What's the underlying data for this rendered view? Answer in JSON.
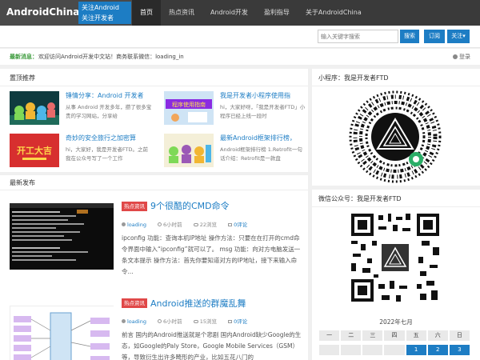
{
  "header": {
    "brand": "AndroidChina",
    "brand_tagline_1": "关注Android",
    "brand_tagline_2": "关注开发者",
    "nav": [
      {
        "label": "首页",
        "active": true
      },
      {
        "label": "热点资讯"
      },
      {
        "label": "Android开发"
      },
      {
        "label": "盈利指导"
      },
      {
        "label": "关于AndroidChina"
      }
    ]
  },
  "search": {
    "placeholder": "输入关键字搜索",
    "search_label": "搜索",
    "subscribe_label": "订阅",
    "follow_label": "关注▾"
  },
  "notice": {
    "label": "最新消息：",
    "text": "欢迎访问Android开发中文站！商务联系微信：loading_in",
    "login": "登录"
  },
  "recommend": {
    "title": "置顶推荐",
    "items": [
      {
        "title": "锤情分享：Android 开发者",
        "desc": "从事 Android 开发多年，攒了很多宝贵的学习网站，分享给"
      },
      {
        "title": "我是开发者小程序使用指",
        "desc": "hi，大家好呀，「我是开发者FTD」小程序已经上线一段时"
      },
      {
        "title": "奇妙的安全旅行之加密算",
        "desc": "hi，大家好，我是开发者FTD。之前我在公众号写了一个工作"
      },
      {
        "title": "最新Android框架排行榜，",
        "desc": "Android框架排行榜 1.Retrofit一句话介绍：Retrofit是一款盘"
      }
    ],
    "thumb2_text": "程序使用指南",
    "thumb3_text": "开工大吉"
  },
  "latest": {
    "title": "最新发布",
    "posts": [
      {
        "tag": "热点资讯",
        "title": "9个很酷的CMD命令",
        "author": "loading",
        "time": "6小时前",
        "views": "22浏览",
        "comments": "0评论",
        "body": "ipconfig 功能：查询本机IP地址 操作方法：只要在在打开的cmd命令界面中输入“ipconfig”就可以了。 msg 功能：向对方电脑发送一条文本提示 操作方法：首先你要知道对方的IP地址，接下来输入命令..."
      },
      {
        "tag": "热点资讯",
        "title": "Android推送的群魔乱舞",
        "author": "loading",
        "time": "6小时前",
        "views": "15浏览",
        "comments": "0评论",
        "body": "前言 国内的Android推送就是个悲剧 国内Android缺少Google的生态，如Google的Paly Store，Google Mobile Services（GSM）等，导致衍生出许多畸形的产业，比如五花八门的"
      }
    ]
  },
  "sidebar": {
    "miniprogram_title": "小程序：我是开发者FTD",
    "wechat_title": "微信公众号：我是开发者FTD",
    "calendar": {
      "month": "2022年七月",
      "weekdays": [
        "一",
        "二",
        "三",
        "四",
        "五",
        "六",
        "日"
      ],
      "first_row": [
        "",
        "",
        "",
        "",
        "1",
        "2",
        "3"
      ]
    }
  },
  "colors": {
    "accent": "#1d7dc4",
    "tag": "#e04848",
    "nav_bg": "#3a3a3a"
  }
}
